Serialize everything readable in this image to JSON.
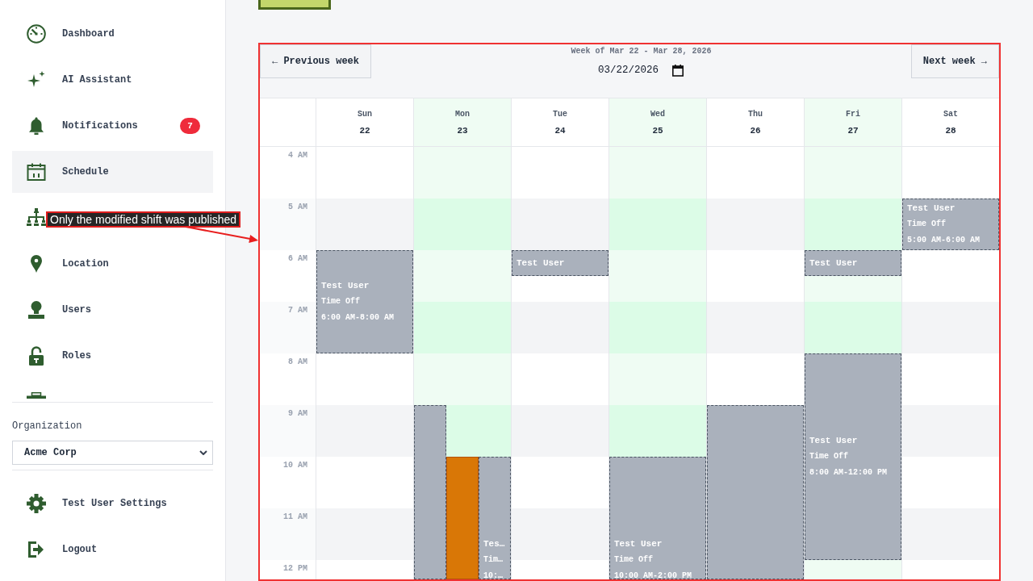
{
  "sidebar": {
    "items": [
      {
        "label": "Dashboard",
        "selected": false
      },
      {
        "label": "AI Assistant",
        "selected": false
      },
      {
        "label": "Notifications",
        "selected": false,
        "badge": "7"
      },
      {
        "label": "Schedule",
        "selected": true
      },
      {
        "selected": false
      },
      {
        "label": "Location",
        "selected": false
      },
      {
        "label": "Users",
        "selected": false
      },
      {
        "label": "Roles",
        "selected": false
      },
      {
        "selected": false
      }
    ],
    "organization": {
      "label": "Organization",
      "value": "Acme Corp"
    },
    "footer_items": [
      {
        "label": "Test User Settings"
      },
      {
        "label": "Logout"
      }
    ]
  },
  "calendar": {
    "previous_button": "← Previous week",
    "week_label": "Week of Mar 22 - Mar 28, 2026",
    "date_value": "03/22/2026",
    "next_button": "Next week →",
    "hours": [
      "4 AM",
      "5 AM",
      "6 AM",
      "7 AM",
      "8 AM",
      "9 AM",
      "10 AM",
      "11 AM",
      "12 PM"
    ],
    "days": [
      {
        "name": "Sun",
        "date": "22",
        "highlighted": false,
        "events": [
          {
            "kind": "draft",
            "title": "Test User",
            "type": "Time Off",
            "time": "6:00 AM-8:00 AM"
          }
        ]
      },
      {
        "name": "Mon",
        "date": "23",
        "highlighted": true,
        "events": [
          {
            "kind": "draft"
          },
          {
            "kind": "published"
          },
          {
            "kind": "draft",
            "title": "Tes…",
            "type": "Tim…",
            "time": "10:…"
          }
        ]
      },
      {
        "name": "Tue",
        "date": "24",
        "highlighted": false,
        "events": [
          {
            "kind": "draft",
            "title": "Test User"
          }
        ]
      },
      {
        "name": "Wed",
        "date": "25",
        "highlighted": true,
        "events": [
          {
            "kind": "draft",
            "title": "Test User",
            "type": "Time Off",
            "time": "10:00 AM-2:00 PM"
          }
        ]
      },
      {
        "name": "Thu",
        "date": "26",
        "highlighted": false,
        "events": [
          {
            "kind": "draft"
          }
        ]
      },
      {
        "name": "Fri",
        "date": "27",
        "highlighted": true,
        "events": [
          {
            "kind": "draft",
            "title": "Test User"
          },
          {
            "kind": "draft",
            "title": "Test User",
            "type": "Time Off",
            "time": "8:00 AM-12:00 PM"
          }
        ]
      },
      {
        "name": "Sat",
        "date": "28",
        "highlighted": false,
        "events": [
          {
            "kind": "draft",
            "title": "Test User",
            "type": "Time Off",
            "time": "5:00 AM-6:00 AM"
          }
        ]
      }
    ]
  },
  "annotation": {
    "text": "Only the modified shift was published"
  }
}
